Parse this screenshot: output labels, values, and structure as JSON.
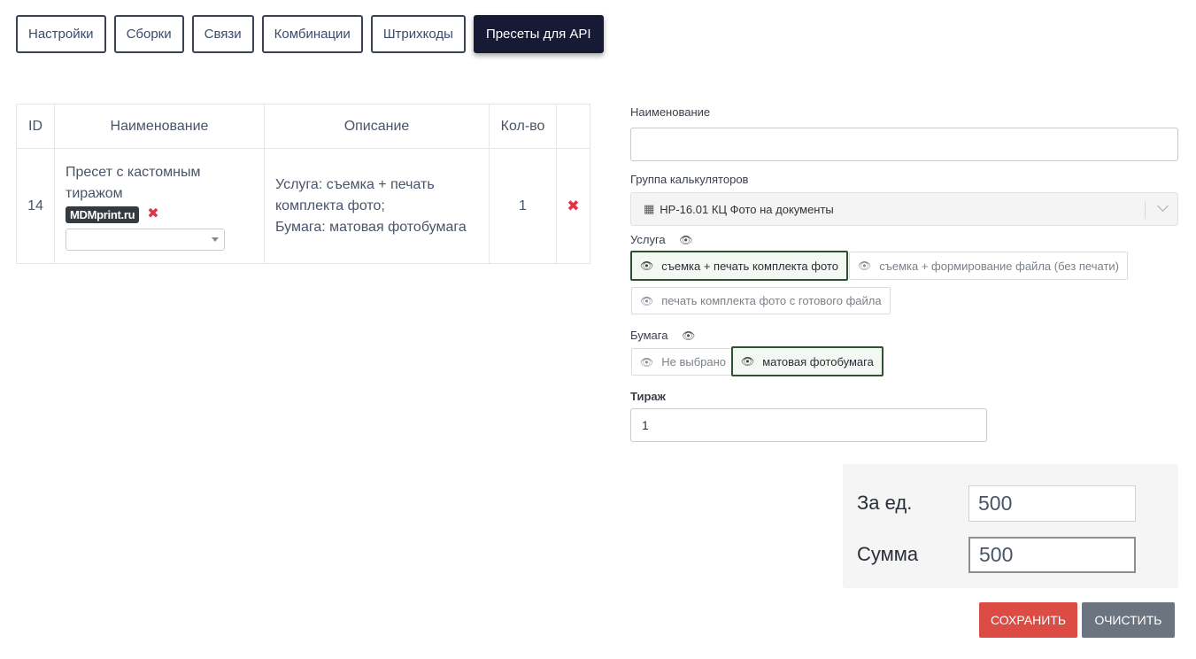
{
  "tabs": [
    {
      "label": "Настройки",
      "active": false
    },
    {
      "label": "Сборки",
      "active": false
    },
    {
      "label": "Связи",
      "active": false
    },
    {
      "label": "Комбинации",
      "active": false
    },
    {
      "label": "Штрихкоды",
      "active": false
    },
    {
      "label": "Пресеты для API",
      "active": true
    }
  ],
  "table": {
    "headers": [
      "ID",
      "Наименование",
      "Описание",
      "Кол-во",
      ""
    ],
    "rows": [
      {
        "id": "14",
        "name": "Пресет с кастомным тиражом",
        "badge": "MDMprint.ru",
        "description_line1": "Услуга: съемка + печать комплекта фото;",
        "description_line2": "Бумага: матовая фотобумага",
        "qty": "1",
        "select_value": ""
      }
    ]
  },
  "form": {
    "name_label": "Наименование",
    "name_value": "",
    "group_label": "Группа калькуляторов",
    "group_value": "HP-16.01 КЦ Фото на документы",
    "service_label": "Услуга",
    "service_options": [
      {
        "label": "съемка + печать комплекта фото",
        "selected": true
      },
      {
        "label": "съемка + формирование файла (без печати)",
        "selected": false
      },
      {
        "label": "печать комплекта фото с готового файла",
        "selected": false
      }
    ],
    "paper_label": "Бумага",
    "paper_options": [
      {
        "label": "Не выбрано",
        "selected": false
      },
      {
        "label": "матовая фотобумага",
        "selected": true
      }
    ],
    "qty_label": "Тираж",
    "qty_value": "1"
  },
  "totals": {
    "unit_label": "За ед.",
    "unit_value": "500",
    "sum_label": "Сумма",
    "sum_value": "500"
  },
  "buttons": {
    "save": "Сохранить",
    "clear": "Очистить"
  },
  "colors": {
    "active_tab": "#171a35",
    "save_button": "#dc4c44",
    "clear_button": "#6c7480",
    "delete_icon": "#dc3545",
    "selected_option_border": "#2e5131"
  },
  "icons": {
    "delete": "cross-icon",
    "visibility": "eye-icon",
    "calculator": "calculator-icon"
  }
}
